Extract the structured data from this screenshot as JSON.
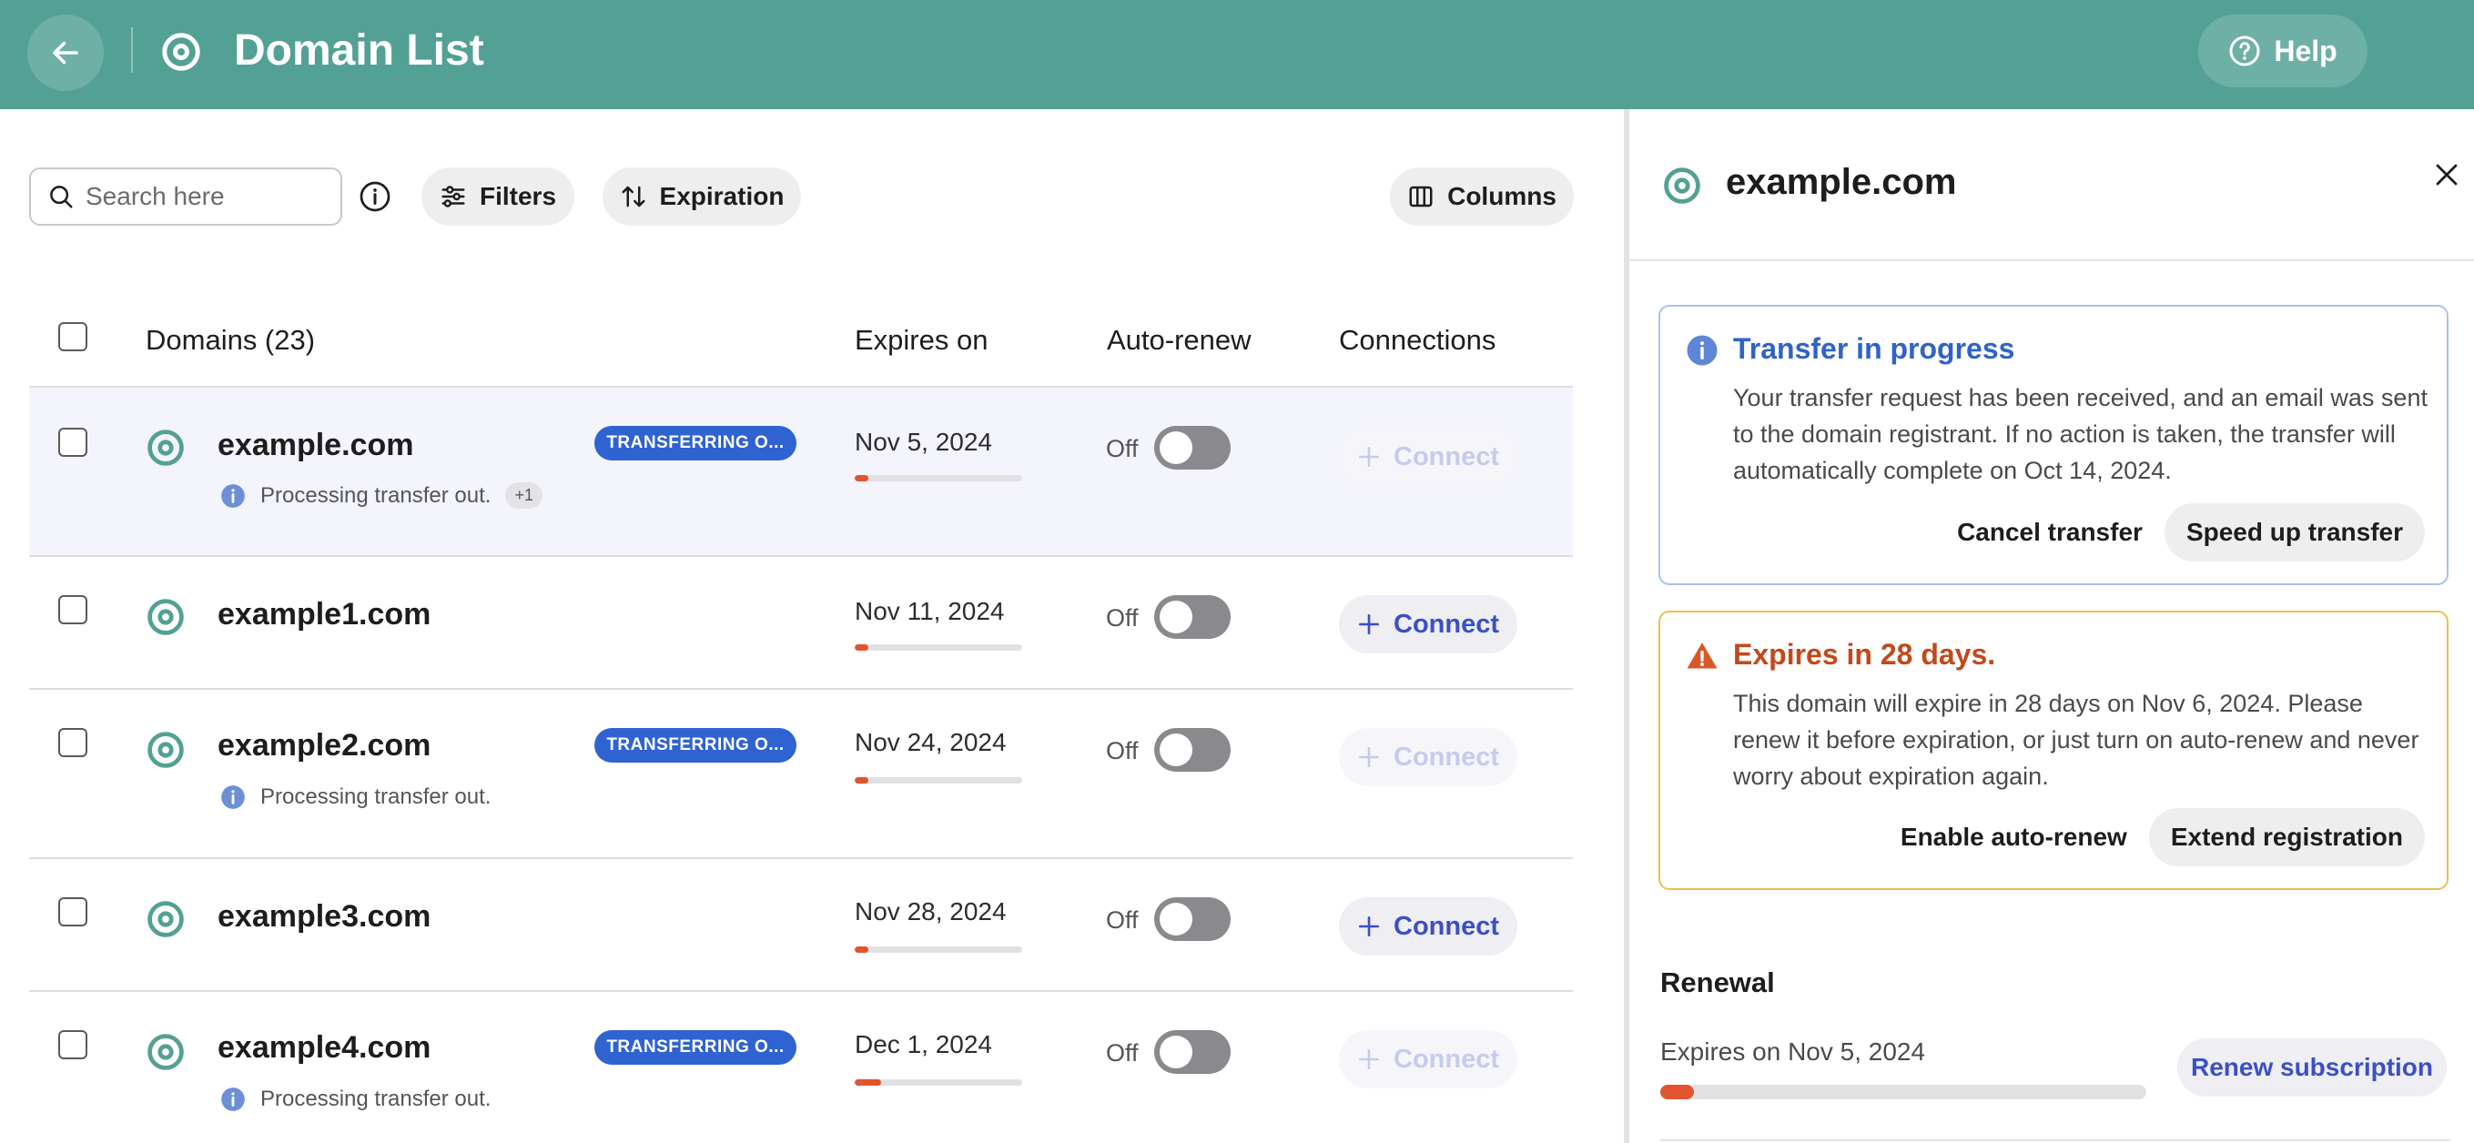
{
  "header": {
    "title": "Domain List",
    "help_label": "Help",
    "color": "#53a194"
  },
  "toolbar": {
    "search_placeholder": "Search here",
    "filters_label": "Filters",
    "expiration_label": "Expiration",
    "columns_label": "Columns"
  },
  "table": {
    "columns": {
      "domains": "Domains (23)",
      "expires": "Expires on",
      "autorenew": "Auto-renew",
      "connections": "Connections"
    },
    "rows": [
      {
        "domain": "example.com",
        "badge": "TRANSFERRING O...",
        "status": "Processing transfer out.",
        "extra": "+1",
        "expires": "Nov 5, 2024",
        "expiry_progress": 0.08,
        "autorenew": "Off",
        "connect": "Connect",
        "connect_enabled": false,
        "selected": true
      },
      {
        "domain": "example1.com",
        "badge": "",
        "status": "",
        "extra": "",
        "expires": "Nov 11, 2024",
        "expiry_progress": 0.08,
        "autorenew": "Off",
        "connect": "Connect",
        "connect_enabled": true,
        "selected": false
      },
      {
        "domain": "example2.com",
        "badge": "TRANSFERRING O...",
        "status": "Processing transfer out.",
        "extra": "",
        "expires": "Nov 24, 2024",
        "expiry_progress": 0.08,
        "autorenew": "Off",
        "connect": "Connect",
        "connect_enabled": false,
        "selected": false
      },
      {
        "domain": "example3.com",
        "badge": "",
        "status": "",
        "extra": "",
        "expires": "Nov 28, 2024",
        "expiry_progress": 0.08,
        "autorenew": "Off",
        "connect": "Connect",
        "connect_enabled": true,
        "selected": false
      },
      {
        "domain": "example4.com",
        "badge": "TRANSFERRING O...",
        "status": "Processing transfer out.",
        "extra": "",
        "expires": "Dec 1, 2024",
        "expiry_progress": 0.16,
        "autorenew": "Off",
        "connect": "Connect",
        "connect_enabled": false,
        "selected": false
      }
    ]
  },
  "panel": {
    "title": "example.com",
    "transfer_alert": {
      "title": "Transfer in progress",
      "body": "Your transfer request has been received, and an email was sent to the domain registrant. If no action is taken, the transfer will automatically complete on Oct 14, 2024.",
      "cancel_label": "Cancel transfer",
      "speed_label": "Speed up transfer"
    },
    "expire_alert": {
      "title": "Expires in 28 days.",
      "body": "This domain will expire in 28 days on Nov 6, 2024. Please renew it before expiration, or just turn on auto-renew and never worry about expiration again.",
      "enable_label": "Enable auto-renew",
      "extend_label": "Extend registration"
    },
    "renewal": {
      "title": "Renewal",
      "expires": "Expires on Nov 5, 2024",
      "progress": 0.07,
      "renew_label": "Renew subscription"
    }
  },
  "colors": {
    "accent": "#53a194",
    "badge": "#2f63d1",
    "link": "#3a4fc7",
    "warning": "#c2491b",
    "info": "#2f63c8",
    "progress": "#e0552e"
  }
}
